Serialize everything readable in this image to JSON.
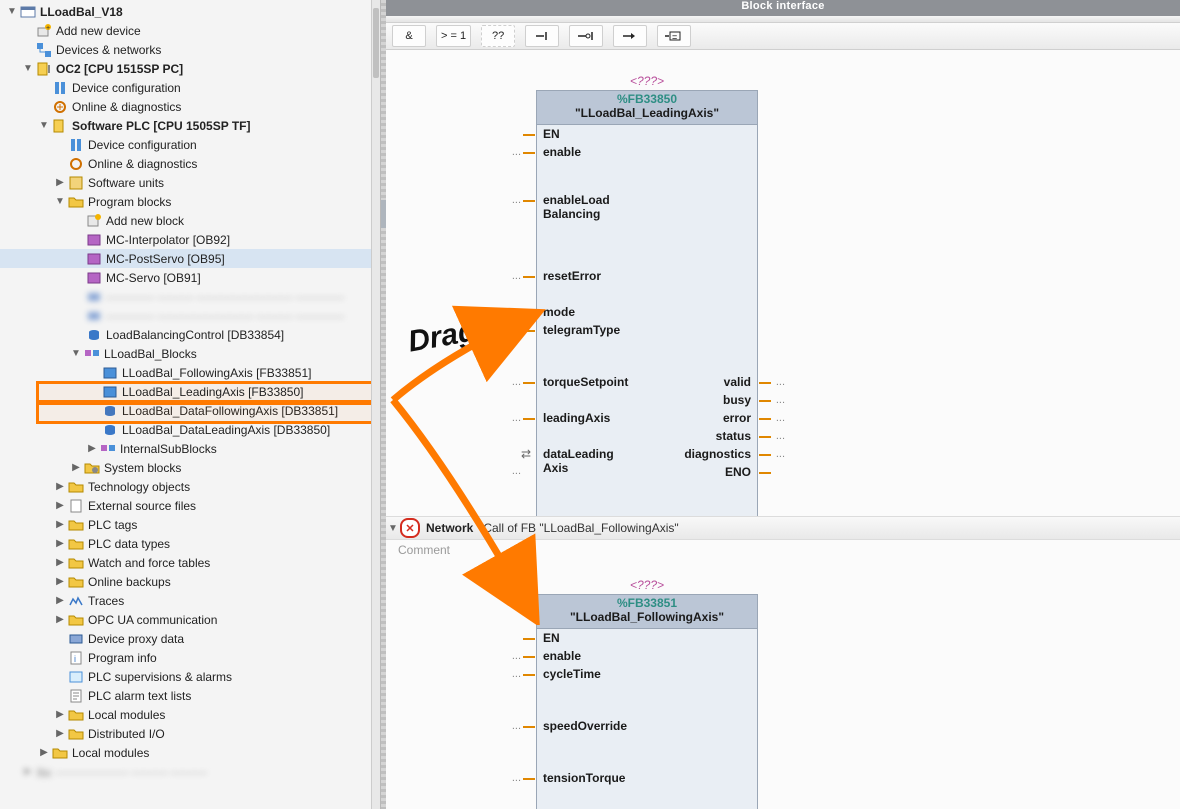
{
  "tree": {
    "root": "LLoadBal_V18",
    "add_device": "Add new device",
    "devnet": "Devices & networks",
    "oc2": "OC2 [CPU 1515SP PC]",
    "dev_conf": "Device configuration",
    "online_diag": "Online & diagnostics",
    "soft_plc": "Software PLC [CPU 1505SP TF]",
    "dev_conf2": "Device configuration",
    "online_diag2": "Online & diagnostics",
    "sw_units": "Software units",
    "prog_blocks": "Program blocks",
    "add_block": "Add new block",
    "mc_interp": "MC-Interpolator [OB92]",
    "mc_postservo": "MC-PostServo [OB95]",
    "mc_servo": "MC-Servo [OB91]",
    "blur1": "———— ——— ———————— ————",
    "blur2": "———— ———————— ——— ————",
    "lbc_db": "LoadBalancingControl [DB33854]",
    "llb_blocks": "LLoadBal_Blocks",
    "llb_follow_fb": "LLoadBal_FollowingAxis [FB33851]",
    "llb_lead_fb": "LLoadBal_LeadingAxis [FB33850]",
    "llb_follow_db": "LLoadBal_DataFollowingAxis [DB33851]",
    "llb_lead_db": "LLoadBal_DataLeadingAxis [DB33850]",
    "isb": "InternalSubBlocks",
    "sys_blocks": "System blocks",
    "tech_obj": "Technology objects",
    "ext_src": "External source files",
    "plc_tags": "PLC tags",
    "plc_dt": "PLC data types",
    "watch": "Watch and force tables",
    "backups": "Online backups",
    "traces": "Traces",
    "opcua": "OPC UA communication",
    "proxy": "Device proxy data",
    "pinfo": "Program info",
    "superv": "PLC supervisions & alarms",
    "alarmtxt": "PLC alarm text lists",
    "localmods": "Local modules",
    "distio": "Distributed I/O",
    "localmods_outer": "Local modules",
    "blur3": "—————— ——— ———"
  },
  "right": {
    "block_interface": "Block interface",
    "ops": {
      "and": "&",
      "gte1": "> = 1",
      "boxq": "??",
      "assign": "⊣",
      "assign_open": "–o|",
      "jump": "↦",
      "jmp_ret": "–[=]"
    },
    "block1": {
      "placeholder": "<???>",
      "fbid": "%FB33850",
      "fbname": "\"LLoadBal_LeadingAxis\"",
      "in": [
        "EN",
        "enable"
      ],
      "in_ml": "enableLoad\nBalancing",
      "in2": [
        "resetError"
      ],
      "in3": [
        "mode",
        "telegramType"
      ],
      "in4": [
        "torqueSetpoint"
      ],
      "in5": [
        "leadingAxis"
      ],
      "inout": "dataLeading\nAxis",
      "out": [
        "valid",
        "busy",
        "error",
        "status",
        "diagnostics",
        "ENO"
      ]
    },
    "network": {
      "label": "Network",
      "desc": "Call of FB \"LLoadBal_FollowingAxis\"",
      "comment": "Comment"
    },
    "block2": {
      "placeholder": "<???>",
      "fbid": "%FB33851",
      "fbname": "\"LLoadBal_FollowingAxis\"",
      "in": [
        "EN",
        "enable",
        "cycleTime"
      ],
      "in2": [
        "speedOverride"
      ],
      "in3": [
        "tensionTorque"
      ]
    }
  },
  "annotation": {
    "drag": "Drag"
  }
}
